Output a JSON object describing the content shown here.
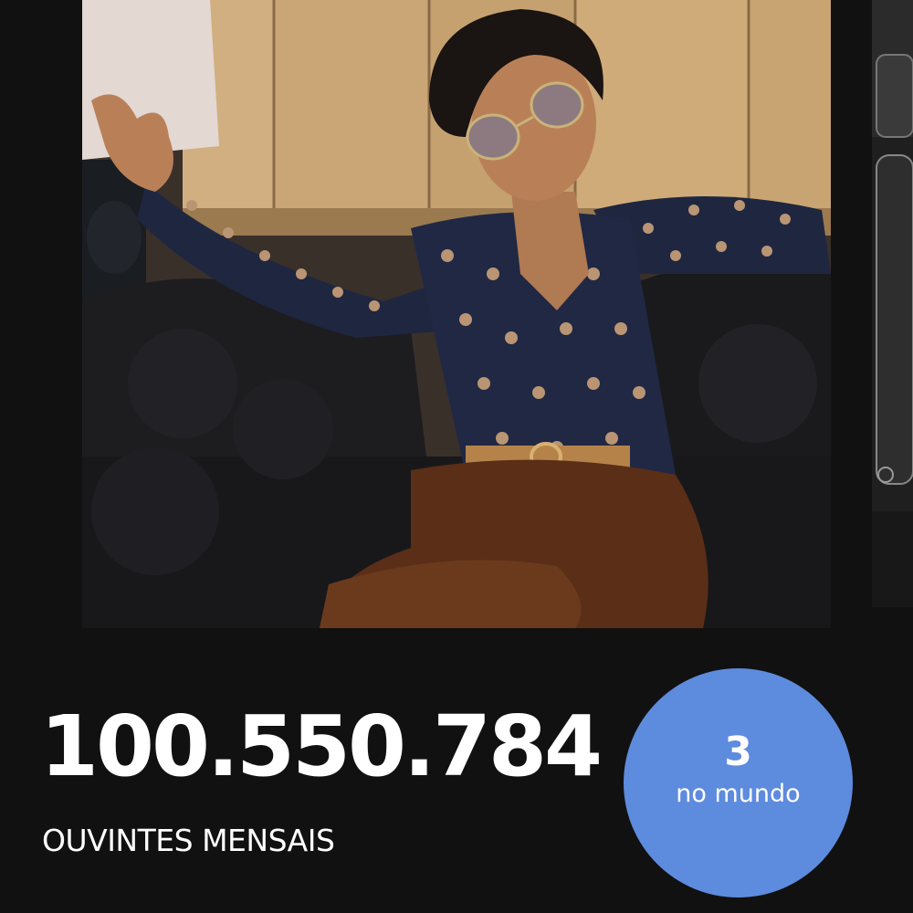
{
  "stats": {
    "monthly_listeners": "100.550.784",
    "monthly_listeners_label": "OUVINTES MENSAIS"
  },
  "rank": {
    "position": "3",
    "scope_label": "no mundo"
  },
  "colors": {
    "background": "#111111",
    "badge": "#5d8bde",
    "text": "#ffffff"
  }
}
